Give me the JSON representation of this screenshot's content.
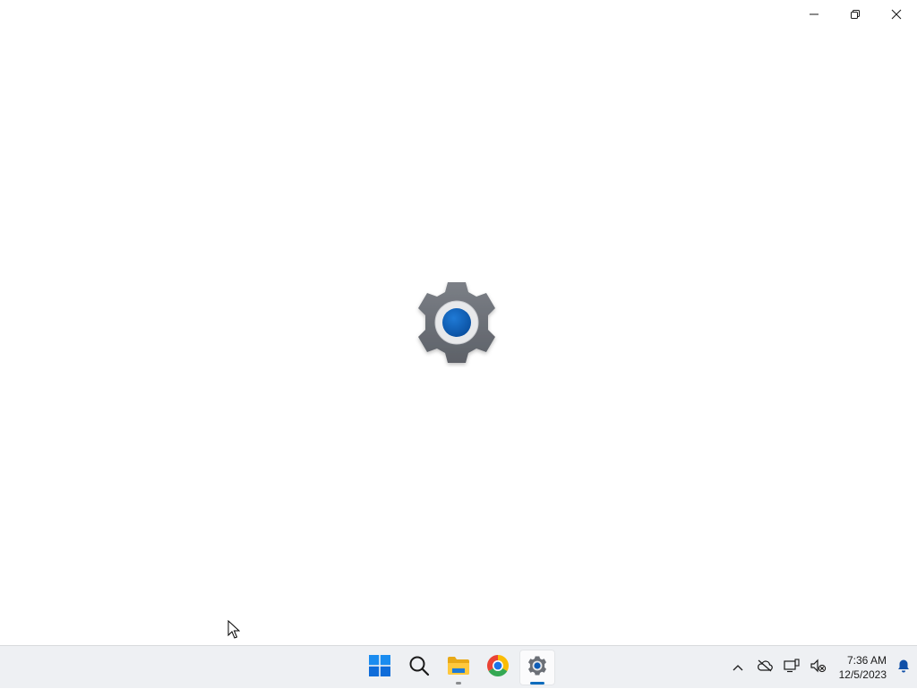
{
  "window": {
    "controls": {
      "minimize_icon": "minimize-icon",
      "restore_icon": "restore-icon",
      "close_icon": "close-icon"
    },
    "splash_icon": "settings-gear-icon"
  },
  "taskbar": {
    "apps": [
      {
        "name": "Start",
        "icon": "windows-logo-icon"
      },
      {
        "name": "Search",
        "icon": "search-icon"
      },
      {
        "name": "File Explorer",
        "icon": "folder-icon",
        "running": true
      },
      {
        "name": "Google Chrome",
        "icon": "chrome-icon"
      },
      {
        "name": "Settings",
        "icon": "settings-gear-icon",
        "running": true,
        "active": true
      }
    ],
    "tray": {
      "icons": [
        "chevron-up-icon",
        "cloud-offline-icon",
        "display-network-icon",
        "speaker-muted-icon",
        "bell-icon"
      ]
    },
    "clock": {
      "time": "7:36 AM",
      "date": "12/5/2023"
    }
  },
  "colors": {
    "accent": "#0f6cbd",
    "taskbar_bg": "#eef0f3",
    "gear_grey": "#6b6f76",
    "gear_blue": "#0d5cb6"
  }
}
